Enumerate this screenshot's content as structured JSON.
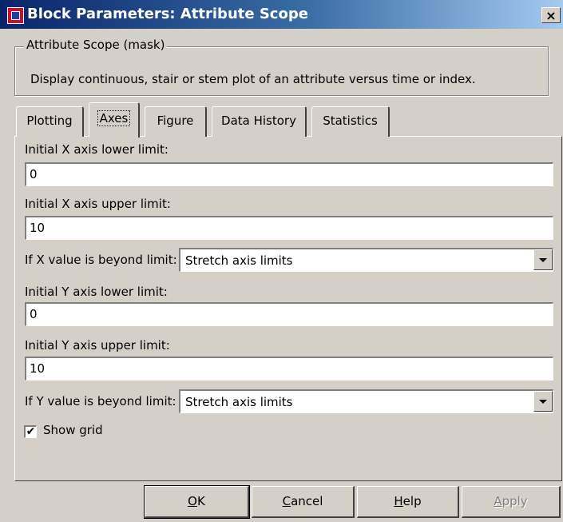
{
  "window": {
    "title": "Block Parameters: Attribute Scope",
    "close_label": "×"
  },
  "mask": {
    "legend": "Attribute Scope (mask)",
    "description": "Display continuous, stair or stem plot of an attribute versus time or index."
  },
  "tabs": [
    {
      "label": "Plotting",
      "active": false
    },
    {
      "label": "Axes",
      "active": true
    },
    {
      "label": "Figure",
      "active": false
    },
    {
      "label": "Data History",
      "active": false
    },
    {
      "label": "Statistics",
      "active": false
    }
  ],
  "axes": {
    "x_lower_label": "Initial X axis lower limit:",
    "x_lower_value": "0",
    "x_upper_label": "Initial X axis upper limit:",
    "x_upper_value": "10",
    "x_beyond_label": "If X value is beyond limit:",
    "x_beyond_value": "Stretch axis limits",
    "y_lower_label": "Initial Y axis lower limit:",
    "y_lower_value": "0",
    "y_upper_label": "Initial Y axis upper limit:",
    "y_upper_value": "10",
    "y_beyond_label": "If Y value is beyond limit:",
    "y_beyond_value": "Stretch axis limits",
    "show_grid_label": "Show grid",
    "show_grid_checked": true
  },
  "buttons": {
    "ok": {
      "mnemonic": "O",
      "rest": "K"
    },
    "cancel": {
      "mnemonic": "C",
      "rest": "ancel"
    },
    "help": {
      "mnemonic": "H",
      "rest": "elp"
    },
    "apply": {
      "mnemonic": "A",
      "rest": "pply"
    }
  }
}
